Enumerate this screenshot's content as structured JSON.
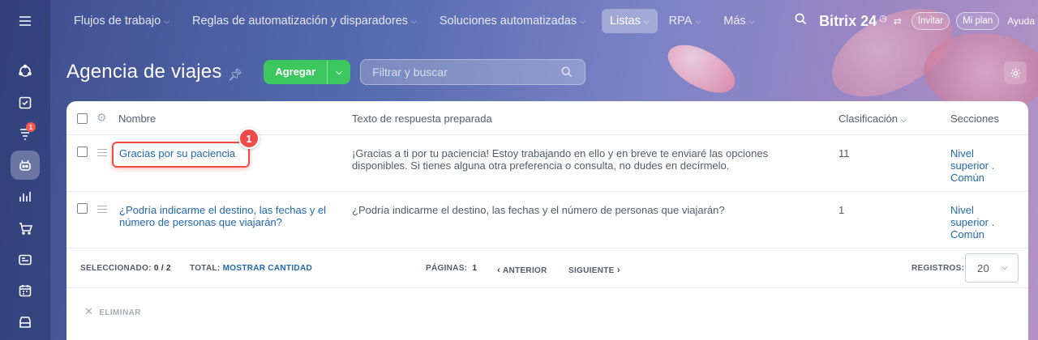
{
  "nav": {
    "items": [
      {
        "label": "Flujos de trabajo",
        "active": false
      },
      {
        "label": "Reglas de automatización y disparadores",
        "active": false
      },
      {
        "label": "Soluciones automatizadas",
        "active": false
      },
      {
        "label": "Listas",
        "active": true
      },
      {
        "label": "RPA",
        "active": false
      },
      {
        "label": "Más",
        "active": false
      }
    ],
    "brand": "Bitrix 24",
    "invite": "Invitar",
    "plan": "Mi plan",
    "help": "Ayuda"
  },
  "sidebar": {
    "badge": "1"
  },
  "header": {
    "title": "Agencia de viajes",
    "add_label": "Agregar",
    "filter_placeholder": "Filtrar y buscar"
  },
  "grid": {
    "columns": {
      "name": "Nombre",
      "text": "Texto de respuesta preparada",
      "sort": "Clasificación",
      "sections": "Secciones"
    },
    "rows": [
      {
        "name": "Gracias por su paciencia",
        "text": "¡Gracias a ti por tu paciencia! Estoy trabajando en ello y en breve te enviaré las opciones disponibles. Si tienes alguna otra preferencia o consulta, no dudes en decírmelo.",
        "sort": "11",
        "section": "Nivel superior . Común"
      },
      {
        "name": "¿Podría indicarme el destino, las fechas y el número de personas que viajarán?",
        "text": "¿Podría indicarme el destino, las fechas y el número de personas que viajarán?",
        "sort": "1",
        "section": "Nivel superior . Común"
      }
    ]
  },
  "annotation": {
    "marker": "1",
    "color": "#ec4b47"
  },
  "footer": {
    "selected_label": "SELECCIONADO:",
    "selected_value": "0 / 2",
    "total_label": "TOTAL:",
    "total_link": "MOSTRAR CANTIDAD",
    "pages_label": "PÁGINAS:",
    "page": "1",
    "prev": "ANTERIOR",
    "next": "SIGUIENTE",
    "records_label": "REGISTROS:",
    "records_value": "20"
  },
  "actions": {
    "delete": "ELIMINAR"
  },
  "colors": {
    "accent_green": "#3bc75e",
    "link_blue": "#2067b0"
  }
}
